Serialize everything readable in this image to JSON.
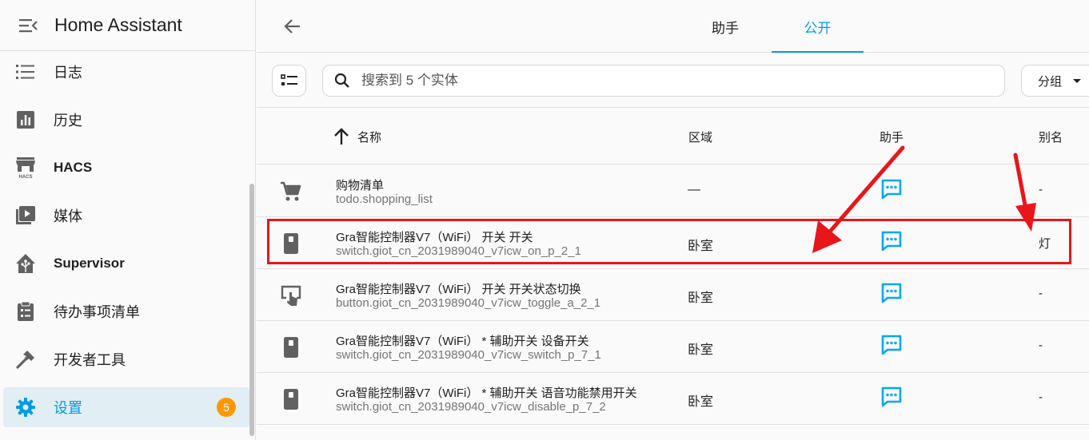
{
  "sidebar": {
    "title": "Home Assistant",
    "items": [
      {
        "label": "日志",
        "icon": "list-icon"
      },
      {
        "label": "历史",
        "icon": "chart-bar-icon"
      },
      {
        "label": "HACS",
        "icon": "hacs-store-icon"
      },
      {
        "label": "媒体",
        "icon": "play-box-multiple-icon"
      },
      {
        "label": "Supervisor",
        "icon": "home-assistant-icon"
      },
      {
        "label": "待办事项清单",
        "icon": "clipboard-list-icon"
      },
      {
        "label": "开发者工具",
        "icon": "hammer-icon"
      },
      {
        "label": "设置",
        "icon": "cog-icon",
        "badge": "5"
      }
    ]
  },
  "header": {
    "tabs": [
      {
        "label": "助手"
      },
      {
        "label": "公开"
      }
    ]
  },
  "toolbar": {
    "search_placeholder": "搜索到 5 个实体",
    "group_label": "分组"
  },
  "table": {
    "columns": [
      "名称",
      "区域",
      "助手",
      "别名"
    ],
    "rows": [
      {
        "name": "购物清单",
        "entity_id": "todo.shopping_list",
        "area": "—",
        "alias": "-",
        "icon": "cart-icon"
      },
      {
        "name": "Gra智能控制器V7（WiFi） 开关 开关",
        "entity_id": "switch.giot_cn_2031989040_v7icw_on_p_2_1",
        "area": "卧室",
        "alias": "灯",
        "icon": "switch-icon"
      },
      {
        "name": "Gra智能控制器V7（WiFi） 开关 开关状态切换",
        "entity_id": "button.giot_cn_2031989040_v7icw_toggle_a_2_1",
        "area": "卧室",
        "alias": "-",
        "icon": "gesture-tap-button-icon"
      },
      {
        "name": "Gra智能控制器V7（WiFi） * 辅助开关 设备开关",
        "entity_id": "switch.giot_cn_2031989040_v7icw_switch_p_7_1",
        "area": "卧室",
        "alias": "-",
        "icon": "switch-icon"
      },
      {
        "name": "Gra智能控制器V7（WiFi） * 辅助开关 语音功能禁用开关",
        "entity_id": "switch.giot_cn_2031989040_v7icw_disable_p_7_2",
        "area": "卧室",
        "alias": "-",
        "icon": "switch-icon"
      }
    ]
  },
  "colors": {
    "accent": "#039be5",
    "badge": "#ff9800",
    "highlight": "#e8161b",
    "assist_icon": "#03a9f4"
  }
}
